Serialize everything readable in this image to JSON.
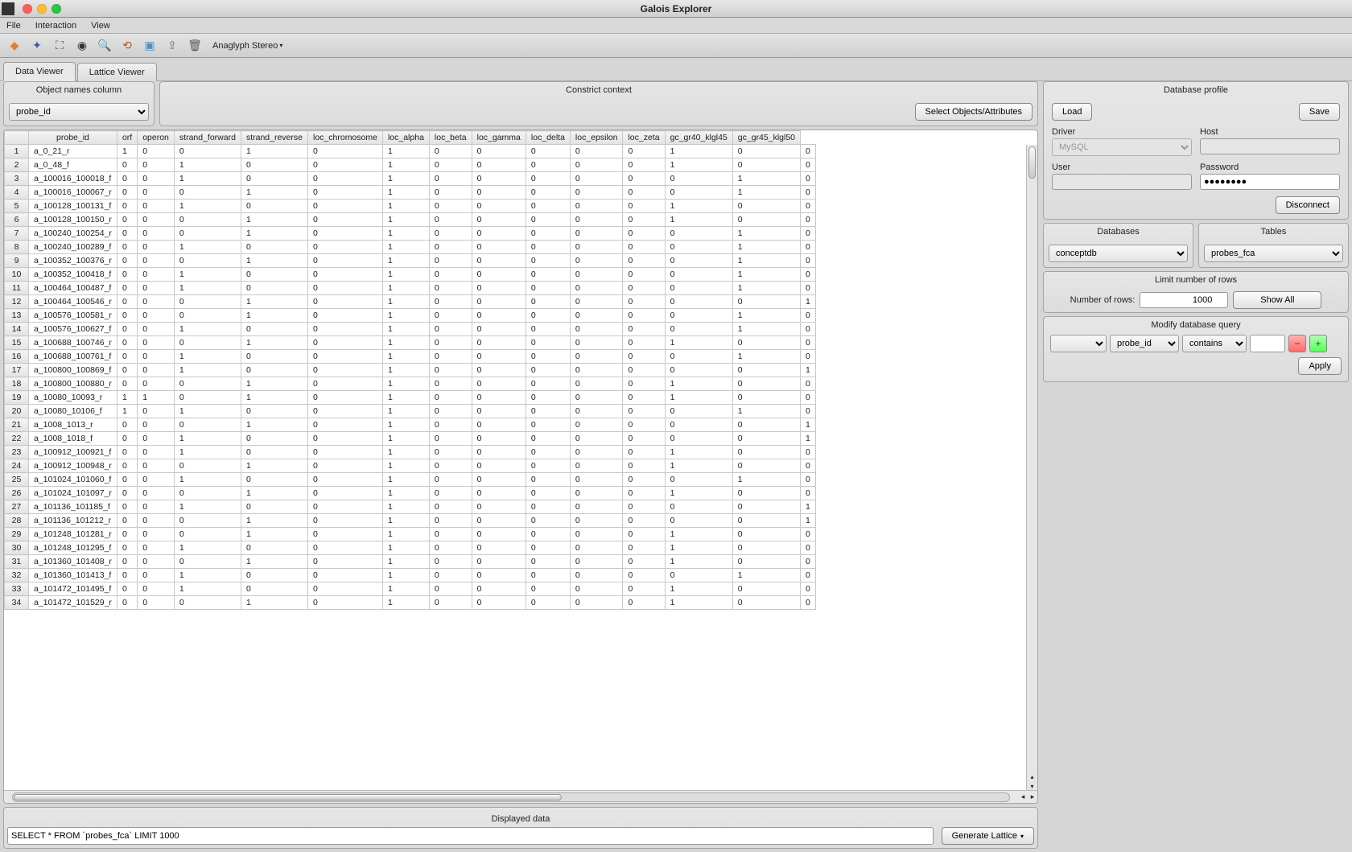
{
  "window": {
    "title": "Galois Explorer"
  },
  "menu": {
    "file": "File",
    "interaction": "Interaction",
    "view": "View"
  },
  "toolbar": {
    "combo": "Anaglyph Stereo"
  },
  "tabs": {
    "data": "Data Viewer",
    "lattice": "Lattice Viewer"
  },
  "objectPanel": {
    "title": "Object names column",
    "selected": "probe_id"
  },
  "constrict": {
    "title": "Constrict context",
    "button": "Select Objects/Attributes"
  },
  "headers": [
    "probe_id",
    "orf",
    "operon",
    "strand_forward",
    "strand_reverse",
    "loc_chromosome",
    "loc_alpha",
    "loc_beta",
    "loc_gamma",
    "loc_delta",
    "loc_epsilon",
    "loc_zeta",
    "gc_gr40_klgl45",
    "gc_gr45_klgl50"
  ],
  "rows": [
    [
      "a_0_21_r",
      "1",
      "0",
      "0",
      "1",
      "0",
      "1",
      "0",
      "0",
      "0",
      "0",
      "0",
      "1",
      "0",
      "0"
    ],
    [
      "a_0_48_f",
      "0",
      "0",
      "1",
      "0",
      "0",
      "1",
      "0",
      "0",
      "0",
      "0",
      "0",
      "1",
      "0",
      "0"
    ],
    [
      "a_100016_100018_f",
      "0",
      "0",
      "1",
      "0",
      "0",
      "1",
      "0",
      "0",
      "0",
      "0",
      "0",
      "0",
      "1",
      "0"
    ],
    [
      "a_100016_100067_r",
      "0",
      "0",
      "0",
      "1",
      "0",
      "1",
      "0",
      "0",
      "0",
      "0",
      "0",
      "0",
      "1",
      "0"
    ],
    [
      "a_100128_100131_f",
      "0",
      "0",
      "1",
      "0",
      "0",
      "1",
      "0",
      "0",
      "0",
      "0",
      "0",
      "1",
      "0",
      "0"
    ],
    [
      "a_100128_100150_r",
      "0",
      "0",
      "0",
      "1",
      "0",
      "1",
      "0",
      "0",
      "0",
      "0",
      "0",
      "1",
      "0",
      "0"
    ],
    [
      "a_100240_100254_r",
      "0",
      "0",
      "0",
      "1",
      "0",
      "1",
      "0",
      "0",
      "0",
      "0",
      "0",
      "0",
      "1",
      "0"
    ],
    [
      "a_100240_100289_f",
      "0",
      "0",
      "1",
      "0",
      "0",
      "1",
      "0",
      "0",
      "0",
      "0",
      "0",
      "0",
      "1",
      "0"
    ],
    [
      "a_100352_100376_r",
      "0",
      "0",
      "0",
      "1",
      "0",
      "1",
      "0",
      "0",
      "0",
      "0",
      "0",
      "0",
      "1",
      "0"
    ],
    [
      "a_100352_100418_f",
      "0",
      "0",
      "1",
      "0",
      "0",
      "1",
      "0",
      "0",
      "0",
      "0",
      "0",
      "0",
      "1",
      "0"
    ],
    [
      "a_100464_100487_f",
      "0",
      "0",
      "1",
      "0",
      "0",
      "1",
      "0",
      "0",
      "0",
      "0",
      "0",
      "0",
      "1",
      "0"
    ],
    [
      "a_100464_100546_r",
      "0",
      "0",
      "0",
      "1",
      "0",
      "1",
      "0",
      "0",
      "0",
      "0",
      "0",
      "0",
      "0",
      "1"
    ],
    [
      "a_100576_100581_r",
      "0",
      "0",
      "0",
      "1",
      "0",
      "1",
      "0",
      "0",
      "0",
      "0",
      "0",
      "0",
      "1",
      "0"
    ],
    [
      "a_100576_100627_f",
      "0",
      "0",
      "1",
      "0",
      "0",
      "1",
      "0",
      "0",
      "0",
      "0",
      "0",
      "0",
      "1",
      "0"
    ],
    [
      "a_100688_100746_r",
      "0",
      "0",
      "0",
      "1",
      "0",
      "1",
      "0",
      "0",
      "0",
      "0",
      "0",
      "1",
      "0",
      "0"
    ],
    [
      "a_100688_100761_f",
      "0",
      "0",
      "1",
      "0",
      "0",
      "1",
      "0",
      "0",
      "0",
      "0",
      "0",
      "0",
      "1",
      "0"
    ],
    [
      "a_100800_100869_f",
      "0",
      "0",
      "1",
      "0",
      "0",
      "1",
      "0",
      "0",
      "0",
      "0",
      "0",
      "0",
      "0",
      "1"
    ],
    [
      "a_100800_100880_r",
      "0",
      "0",
      "0",
      "1",
      "0",
      "1",
      "0",
      "0",
      "0",
      "0",
      "0",
      "1",
      "0",
      "0"
    ],
    [
      "a_10080_10093_r",
      "1",
      "1",
      "0",
      "1",
      "0",
      "1",
      "0",
      "0",
      "0",
      "0",
      "0",
      "1",
      "0",
      "0"
    ],
    [
      "a_10080_10106_f",
      "1",
      "0",
      "1",
      "0",
      "0",
      "1",
      "0",
      "0",
      "0",
      "0",
      "0",
      "0",
      "1",
      "0"
    ],
    [
      "a_1008_1013_r",
      "0",
      "0",
      "0",
      "1",
      "0",
      "1",
      "0",
      "0",
      "0",
      "0",
      "0",
      "0",
      "0",
      "1"
    ],
    [
      "a_1008_1018_f",
      "0",
      "0",
      "1",
      "0",
      "0",
      "1",
      "0",
      "0",
      "0",
      "0",
      "0",
      "0",
      "0",
      "1"
    ],
    [
      "a_100912_100921_f",
      "0",
      "0",
      "1",
      "0",
      "0",
      "1",
      "0",
      "0",
      "0",
      "0",
      "0",
      "1",
      "0",
      "0"
    ],
    [
      "a_100912_100948_r",
      "0",
      "0",
      "0",
      "1",
      "0",
      "1",
      "0",
      "0",
      "0",
      "0",
      "0",
      "1",
      "0",
      "0"
    ],
    [
      "a_101024_101060_f",
      "0",
      "0",
      "1",
      "0",
      "0",
      "1",
      "0",
      "0",
      "0",
      "0",
      "0",
      "0",
      "1",
      "0"
    ],
    [
      "a_101024_101097_r",
      "0",
      "0",
      "0",
      "1",
      "0",
      "1",
      "0",
      "0",
      "0",
      "0",
      "0",
      "1",
      "0",
      "0"
    ],
    [
      "a_101136_101185_f",
      "0",
      "0",
      "1",
      "0",
      "0",
      "1",
      "0",
      "0",
      "0",
      "0",
      "0",
      "0",
      "0",
      "1"
    ],
    [
      "a_101136_101212_r",
      "0",
      "0",
      "0",
      "1",
      "0",
      "1",
      "0",
      "0",
      "0",
      "0",
      "0",
      "0",
      "0",
      "1"
    ],
    [
      "a_101248_101281_r",
      "0",
      "0",
      "0",
      "1",
      "0",
      "1",
      "0",
      "0",
      "0",
      "0",
      "0",
      "1",
      "0",
      "0"
    ],
    [
      "a_101248_101295_f",
      "0",
      "0",
      "1",
      "0",
      "0",
      "1",
      "0",
      "0",
      "0",
      "0",
      "0",
      "1",
      "0",
      "0"
    ],
    [
      "a_101360_101408_r",
      "0",
      "0",
      "0",
      "1",
      "0",
      "1",
      "0",
      "0",
      "0",
      "0",
      "0",
      "1",
      "0",
      "0"
    ],
    [
      "a_101360_101413_f",
      "0",
      "0",
      "1",
      "0",
      "0",
      "1",
      "0",
      "0",
      "0",
      "0",
      "0",
      "0",
      "1",
      "0"
    ],
    [
      "a_101472_101495_f",
      "0",
      "0",
      "1",
      "0",
      "0",
      "1",
      "0",
      "0",
      "0",
      "0",
      "0",
      "1",
      "0",
      "0"
    ],
    [
      "a_101472_101529_r",
      "0",
      "0",
      "0",
      "1",
      "0",
      "1",
      "0",
      "0",
      "0",
      "0",
      "0",
      "1",
      "0",
      "0"
    ]
  ],
  "displayed": {
    "title": "Displayed data",
    "sql": "SELECT * FROM `probes_fca` LIMIT 1000",
    "generate": "Generate Lattice"
  },
  "profile": {
    "title": "Database profile",
    "load": "Load",
    "save": "Save",
    "driverLabel": "Driver",
    "driver": "MySQL",
    "hostLabel": "Host",
    "host": "",
    "userLabel": "User",
    "user": "",
    "passwordLabel": "Password",
    "password": "●●●●●●●●",
    "disconnect": "Disconnect",
    "databasesLabel": "Databases",
    "database": "conceptdb",
    "tablesLabel": "Tables",
    "table": "probes_fca",
    "limitTitle": "Limit number of rows",
    "rowsLabel": "Number of rows:",
    "rows": "1000",
    "showAll": "Show All",
    "modifyTitle": "Modify database query",
    "queryField": "probe_id",
    "queryOp": "contains",
    "queryVal": "",
    "apply": "Apply"
  }
}
